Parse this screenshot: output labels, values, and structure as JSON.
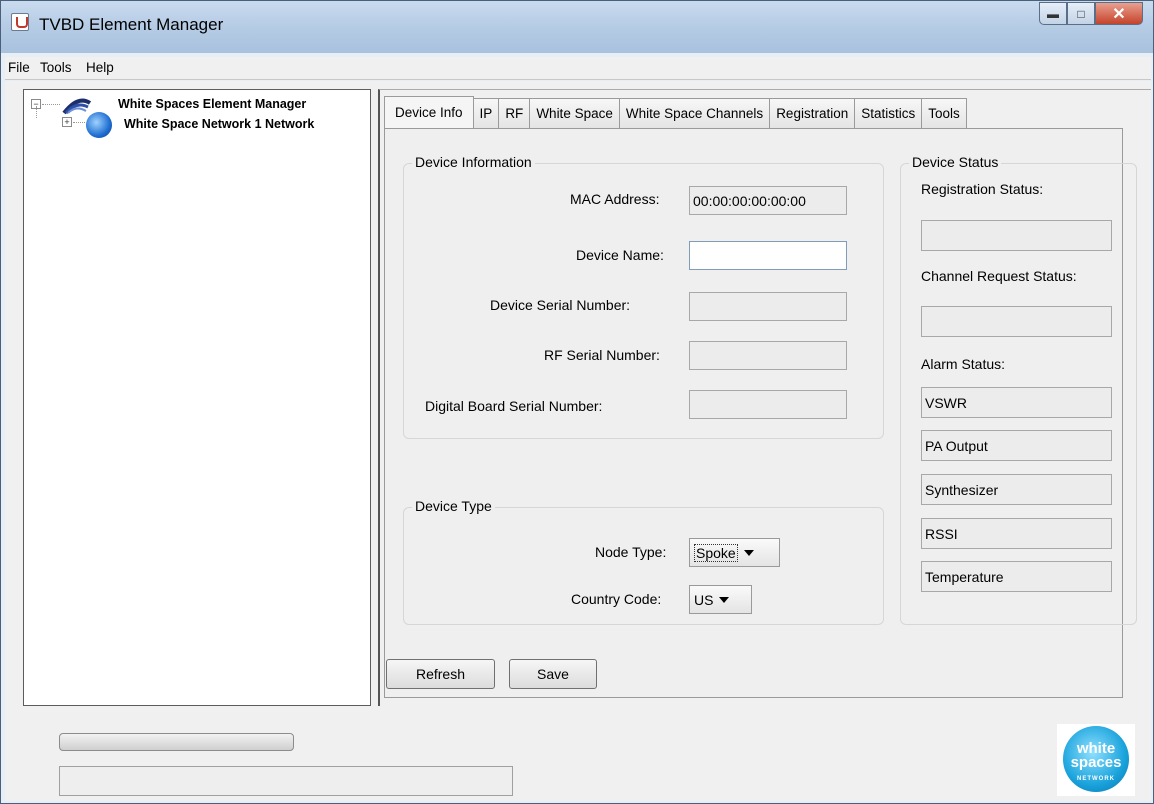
{
  "window": {
    "title": "TVBD Element Manager"
  },
  "menu": [
    "File",
    "Tools",
    "Help"
  ],
  "tree": {
    "root_label": "White Spaces Element Manager",
    "child_label": "White Space Network 1 Network"
  },
  "tabs": [
    "Device Info",
    "IP",
    "RF",
    "White Space",
    "White Space Channels",
    "Registration",
    "Statistics",
    "Tools"
  ],
  "device_info": {
    "title": "Device Information",
    "mac_label": "MAC Address:",
    "mac_value": "00:00:00:00:00:00",
    "name_label": "Device Name:",
    "name_value": "",
    "serial_label": "Device Serial Number:",
    "serial_value": "",
    "rf_serial_label": "RF Serial Number:",
    "rf_serial_value": "",
    "digital_label": "Digital Board Serial Number:",
    "digital_value": ""
  },
  "device_type": {
    "title": "Device Type",
    "node_label": "Node Type:",
    "node_value": "Spoke",
    "country_label": "Country Code:",
    "country_value": "US"
  },
  "device_status": {
    "title": "Device Status",
    "registration_label": "Registration Status:",
    "registration_value": "",
    "channel_label": "Channel Request Status:",
    "channel_value": "",
    "alarm_label": "Alarm Status:",
    "alarms": [
      "VSWR",
      "PA Output",
      "Synthesizer",
      "RSSI",
      "Temperature"
    ]
  },
  "buttons": {
    "refresh": "Refresh",
    "save": "Save"
  },
  "logo": {
    "line1": "white",
    "line2": "spaces",
    "line3": "NETWORK"
  }
}
